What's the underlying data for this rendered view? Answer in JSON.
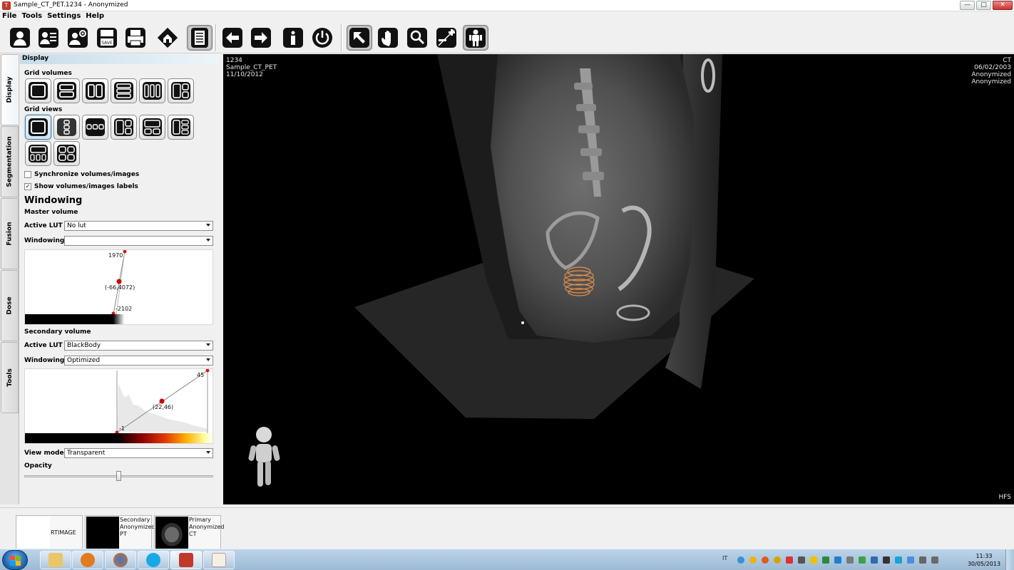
{
  "window": {
    "title": "Sample_CT_PET.1234 - Anonymized",
    "controls": {
      "minimize": "—",
      "maximize": "□",
      "close": "✕"
    }
  },
  "menu": [
    "File",
    "Tools",
    "Settings",
    "Help"
  ],
  "toolbar": {
    "icons": [
      "patient-icon",
      "patient-list-icon",
      "patient-settings-icon",
      "save-icon",
      "print-icon",
      "home-icon",
      "report-icon",
      "back-arrow-icon",
      "forward-arrow-icon",
      "info-icon",
      "power-icon",
      "pointer-icon",
      "hand-pan-icon",
      "zoom-icon",
      "window-level-icon",
      "person-icon"
    ],
    "save_text": "SAVE"
  },
  "tabs": [
    "Display",
    "Segmentation",
    "Fusion",
    "Dose",
    "Tools"
  ],
  "panel": {
    "header": "Display",
    "grid_volumes_label": "Grid volumes",
    "grid_views_label": "Grid  views",
    "sync_label": "Synchronize volumes/images",
    "sync_checked": false,
    "show_labels_label": "Show volumes/images labels",
    "show_labels_checked": true,
    "windowing_heading": "Windowing",
    "master_volume_label": "Master volume",
    "active_lut_label": "Active LUT",
    "windowing_label": "Windowing",
    "master_active_lut": "No lut",
    "master_windowing": "",
    "master_hist": {
      "top": "1970",
      "point": "(-66,4072)",
      "bottom": "-2102"
    },
    "secondary_volume_label": "Secondary volume",
    "secondary_active_lut": "BlackBody",
    "secondary_windowing": "Optimized",
    "secondary_hist": {
      "top": "45",
      "point": "(22,46)",
      "bottom": "-1"
    },
    "view_mode_label": "View mode",
    "view_mode": "Transparent",
    "opacity_label": "Opacity",
    "opacity_value": 0.5
  },
  "viewer": {
    "top_left": [
      "1234",
      "Sample_CT_PET",
      "11/10/2012"
    ],
    "top_right": [
      "CT",
      "06/02/2003",
      "Anonymized",
      "Anonymized"
    ],
    "bottom_right": "HFS"
  },
  "thumbnails": [
    {
      "lines": [
        "RTIMAGE"
      ]
    },
    {
      "lines": [
        "Secondary",
        "Anonymized",
        "PT"
      ]
    },
    {
      "lines": [
        "Primary",
        "Anonymized",
        "CT"
      ]
    }
  ],
  "taskbar": {
    "language": "IT",
    "time": "11:33",
    "date": "30/05/2013"
  },
  "colors": {
    "panel_header": "#c6dce9",
    "viewer_bg": "#000000",
    "contour": "#e8904a",
    "taskbar": "#9dbad4"
  }
}
